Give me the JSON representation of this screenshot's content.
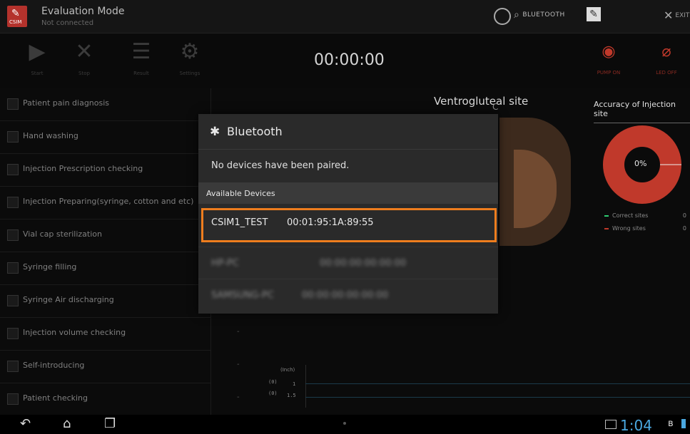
{
  "titlebar": {
    "logo_text": "CSIM",
    "mode_title": "Evaluation Mode",
    "mode_subtitle": "Not connected",
    "bluetooth_label": "BLUETOOTH",
    "exit_label": "EXIT"
  },
  "toolbar": {
    "tools": [
      {
        "icon": "play-icon",
        "label": "Start"
      },
      {
        "icon": "stop-icon",
        "label": "Stop"
      },
      {
        "icon": "list-icon",
        "label": "Result"
      },
      {
        "icon": "gear-icon",
        "label": "Settings"
      }
    ],
    "timer": "00:00:00",
    "pump_label": "PUMP ON",
    "led_label": "LED OFF"
  },
  "checklist": [
    {
      "label": "Patient pain diagnosis",
      "value": ""
    },
    {
      "label": "Hand washing",
      "value": ""
    },
    {
      "label": "Injection Prescription checking",
      "value": ""
    },
    {
      "label": "Injection Preparing(syringe, cotton and etc)",
      "value": ""
    },
    {
      "label": "Vial cap sterilization",
      "value": ""
    },
    {
      "label": "Syringe filling",
      "value": ""
    },
    {
      "label": "Syringe Air discharging",
      "value": ""
    },
    {
      "label": "Injection volume checking",
      "value": "-"
    },
    {
      "label": "Self-introducing",
      "value": "-"
    },
    {
      "label": "Patient checking",
      "value": "-"
    }
  ],
  "site": {
    "title": "Ventrogluteal site"
  },
  "accuracy": {
    "title": "Accuracy of Injection site",
    "percent_label": "0%",
    "percent": 0,
    "color_correct": "#2ecc71",
    "color_wrong": "#c0392b",
    "legend": [
      {
        "label": "Correct sites",
        "value": "0"
      },
      {
        "label": "Wrong sites",
        "value": "0"
      }
    ]
  },
  "graph": {
    "unit": "(Inch)",
    "rows": [
      {
        "left": "(0)",
        "right": "1"
      },
      {
        "left": "(0)",
        "right": "1.5"
      }
    ]
  },
  "dialog": {
    "title": "Bluetooth",
    "no_devices": "No devices have been paired.",
    "available_header": "Available Devices",
    "devices": [
      {
        "name": "CSIM1_TEST",
        "address": "00:01:95:1A:89:55"
      },
      {
        "name": "HP-PC",
        "address": "00:00:00:00:00:00"
      },
      {
        "name": "SAMSUNG-PC",
        "address": "00:00:00:00:00:00"
      }
    ]
  },
  "statusbar": {
    "time": "1:04"
  },
  "colors": {
    "highlight": "#ee7d1e",
    "accent_red": "#c0392b",
    "clock_blue": "#4aa8e0"
  }
}
